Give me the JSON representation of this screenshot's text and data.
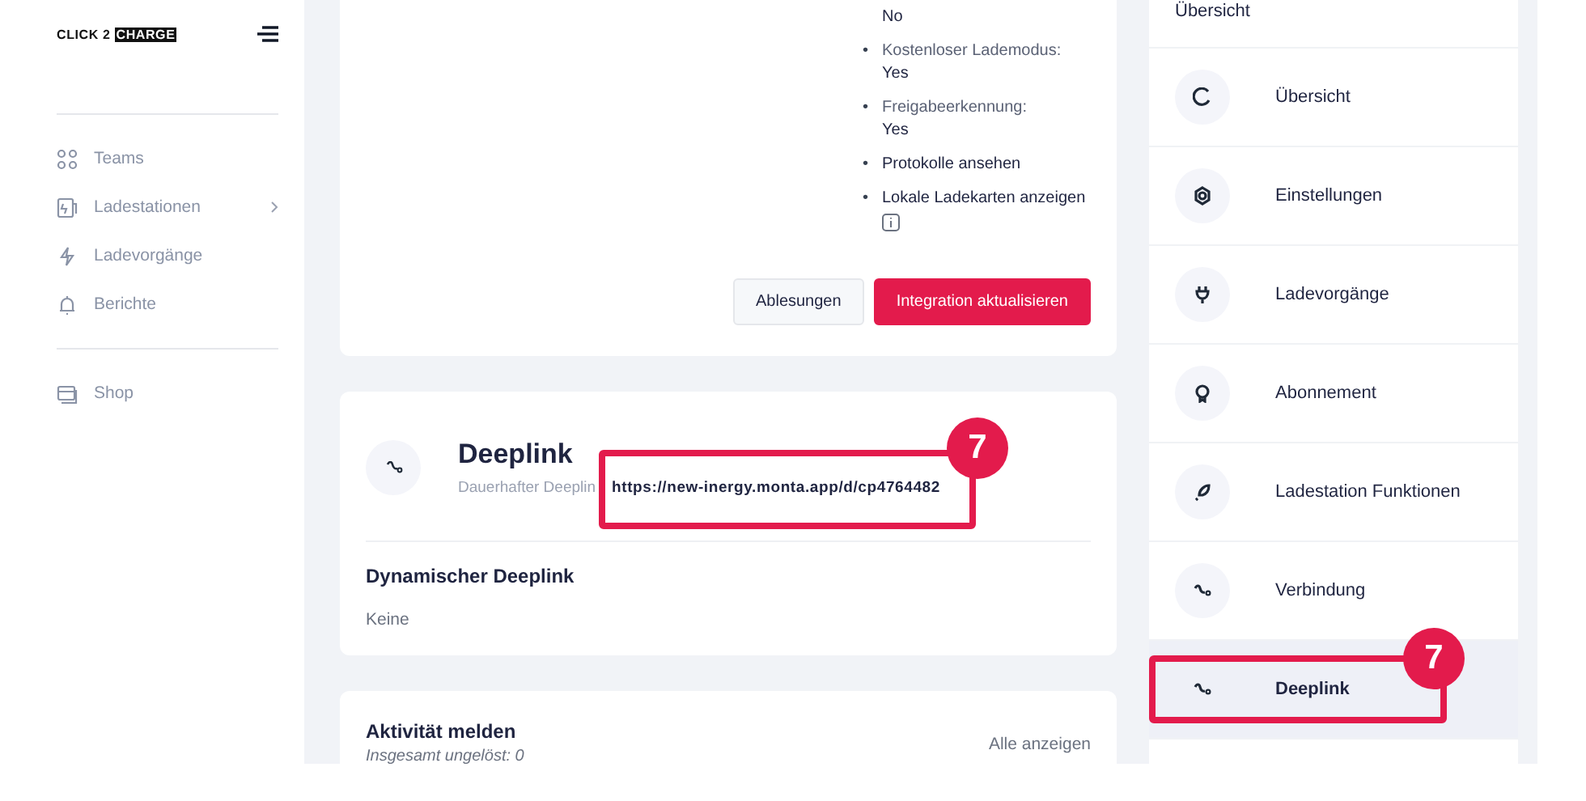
{
  "sidebar": {
    "logo": {
      "part1": "CLICK 2",
      "part2": "CHARGE"
    },
    "groups": [
      [
        {
          "label": "Teams",
          "chevron": false
        },
        {
          "label": "Ladestationen",
          "chevron": true
        },
        {
          "label": "Ladevorgänge",
          "chevron": false
        },
        {
          "label": "Berichte",
          "chevron": false
        }
      ],
      [
        {
          "label": "Shop",
          "chevron": false
        }
      ]
    ]
  },
  "settings_card": {
    "items": [
      {
        "value": "No"
      },
      {
        "bullet": "•",
        "label": "Kostenloser Lademodus:",
        "value": "Yes"
      },
      {
        "bullet": "•",
        "label": "Freigabeerkennung:",
        "value": "Yes"
      },
      {
        "bullet": "•",
        "label": "Protokolle ansehen"
      },
      {
        "bullet": "•",
        "label": "Lokale Ladekarten anzeigen",
        "info": true
      }
    ],
    "buttons": [
      {
        "label": "Ablesungen",
        "primary": false
      },
      {
        "label": "Integration aktualisieren",
        "primary": true
      }
    ]
  },
  "deeplink_card": {
    "title": "Deeplink",
    "subtitle": "Dauerhafter Deeplin",
    "url": "https://new-inergy.monta.app/d/cp4764482",
    "annotation": "7",
    "dynamic_title": "Dynamischer Deeplink",
    "dynamic_value": "Keine"
  },
  "activity_card": {
    "title": "Aktivität melden",
    "subtitle": "Insgesamt ungelöst: 0",
    "link": "Alle anzeigen"
  },
  "right_nav": {
    "heading": "Übersicht",
    "items": [
      {
        "label": "Übersicht",
        "selected": false
      },
      {
        "label": "Einstellungen",
        "selected": false
      },
      {
        "label": "Ladevorgänge",
        "selected": false
      },
      {
        "label": "Abonnement",
        "selected": false
      },
      {
        "label": "Ladestation Funktionen",
        "selected": false
      },
      {
        "label": "Verbindung",
        "selected": false
      },
      {
        "label": "Deeplink",
        "selected": true,
        "annotation": "7"
      }
    ]
  }
}
